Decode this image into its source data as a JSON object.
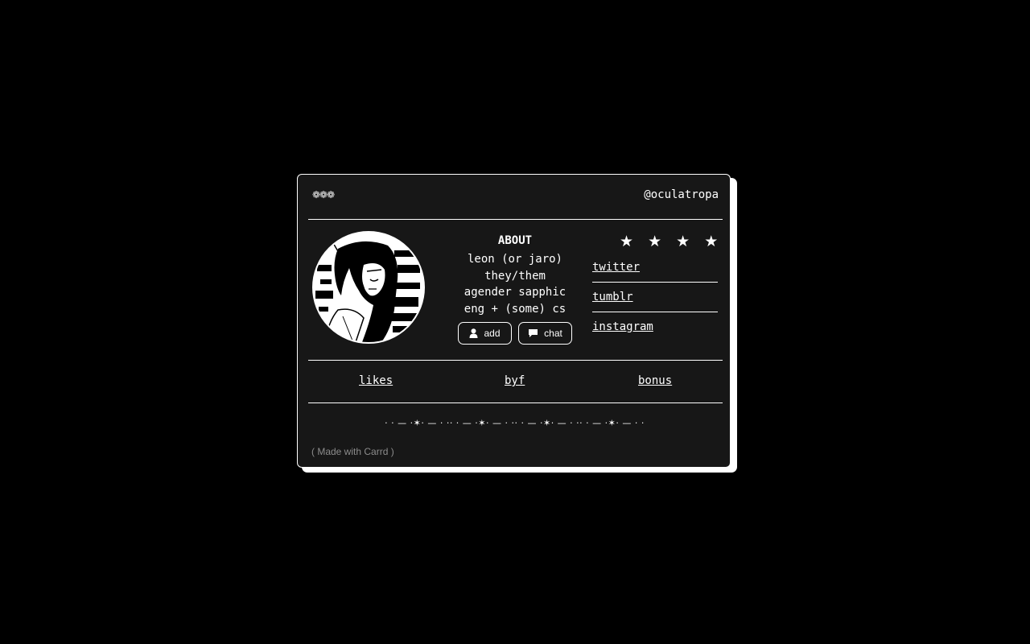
{
  "header": {
    "icons_text": "❁❁❁",
    "handle": "@oculatropa"
  },
  "about": {
    "title": "ABOUT",
    "lines": [
      "leon (or jaro)",
      "they/them",
      "agender sapphic",
      "eng + (some) cs"
    ]
  },
  "buttons": {
    "add": {
      "label": "add",
      "icon": "user-icon"
    },
    "chat": {
      "label": "chat",
      "icon": "speech-bubble-icon"
    }
  },
  "stars": "★ ★ ★ ★",
  "links": [
    "twitter",
    "tumblr",
    "instagram"
  ],
  "nav": [
    "likes",
    "byf",
    "bonus"
  ],
  "divider_text": "· · — ·✶· — · ·· · — ·✶· — · ·· · — ·✶· — · ·· · — ·✶· — · ·",
  "footer": {
    "made_with": "( Made with Carrd )"
  },
  "colors": {
    "page_bg": "#000000",
    "card_bg": "#171717",
    "border": "#ffffff",
    "footer_text": "#8c8c8c"
  }
}
